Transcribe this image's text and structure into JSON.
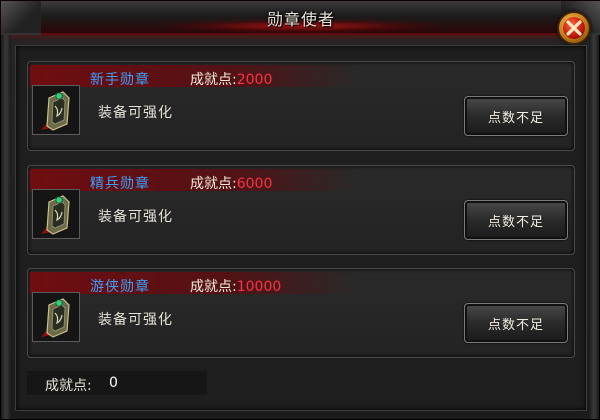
{
  "window": {
    "title": "勋章使者"
  },
  "points_prefix": "成就点:",
  "medals": [
    {
      "name": "新手勋章",
      "points": "2000",
      "description": "装备可强化",
      "button_label": "点数不足"
    },
    {
      "name": "精兵勋章",
      "points": "6000",
      "description": "装备可强化",
      "button_label": "点数不足"
    },
    {
      "name": "游侠勋章",
      "points": "10000",
      "description": "装备可强化",
      "button_label": "点数不足"
    }
  ],
  "footer": {
    "label": "成就点:",
    "value": "0"
  },
  "icons": {
    "close": "close-icon",
    "medal": "medal-icon"
  },
  "colors": {
    "medal_name": "#3aa0ff",
    "points_value": "#ff3040",
    "header_red": "#780a0e"
  }
}
